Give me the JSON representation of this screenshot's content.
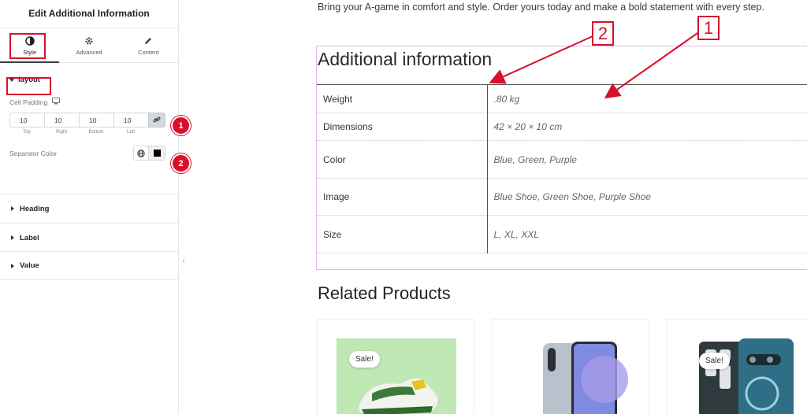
{
  "panel": {
    "title": "Edit Additional Information",
    "tabs": [
      {
        "label": "Style",
        "icon": "half-circle-icon"
      },
      {
        "label": "Advanced",
        "icon": "gear-icon"
      },
      {
        "label": "Content",
        "icon": "pencil-icon"
      }
    ],
    "layout_section": {
      "title": "layout",
      "cell_padding_label": "Cell Padding",
      "padding_values": [
        "10",
        "10",
        "10",
        "10"
      ],
      "padding_sides": [
        "Top",
        "Right",
        "Bottom",
        "Left"
      ],
      "separator_label": "Separator Color",
      "separator_color": "#000000"
    },
    "collapsed_sections": [
      "Heading",
      "Label",
      "Value"
    ],
    "badges": [
      "1",
      "2"
    ]
  },
  "content": {
    "intro": "Bring your A-game in comfort and style. Order yours today and make a bold statement with every step.",
    "info_title": "Additional information",
    "rows": [
      {
        "label": "Weight",
        "value": ".80 kg"
      },
      {
        "label": "Dimensions",
        "value": "42 × 20 × 10 cm"
      },
      {
        "label": "Color",
        "value": "Blue, Green, Purple"
      },
      {
        "label": "Image",
        "value": "Blue Shoe, Green Shoe, Purple Shoe"
      },
      {
        "label": "Size",
        "value": "L, XL, XXL"
      }
    ],
    "related_title": "Related Products",
    "sale_label": "Sale!",
    "annotations": [
      "1",
      "2"
    ]
  },
  "colors": {
    "accent_red": "#d8102b",
    "box_border": "#e3b7e8"
  }
}
